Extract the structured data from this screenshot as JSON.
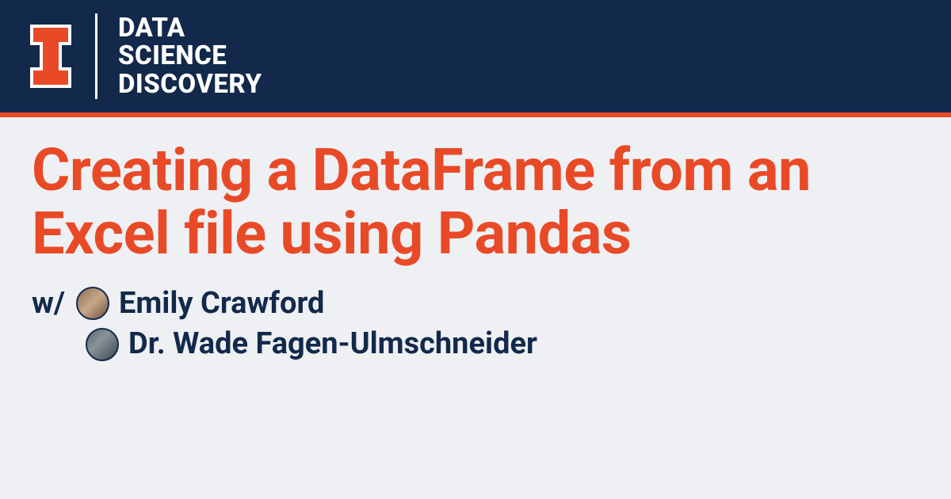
{
  "header": {
    "wordmark_line1": "DATA",
    "wordmark_line2": "SCIENCE",
    "wordmark_line3": "DISCOVERY"
  },
  "title": "Creating a DataFrame from an Excel file using Pandas",
  "authors": {
    "prefix": "w/",
    "list": [
      {
        "name": "Emily Crawford"
      },
      {
        "name": "Dr. Wade Fagen-Ulmschneider"
      }
    ]
  },
  "colors": {
    "navy": "#13294b",
    "orange": "#e84a27",
    "background": "#eef0f3"
  }
}
